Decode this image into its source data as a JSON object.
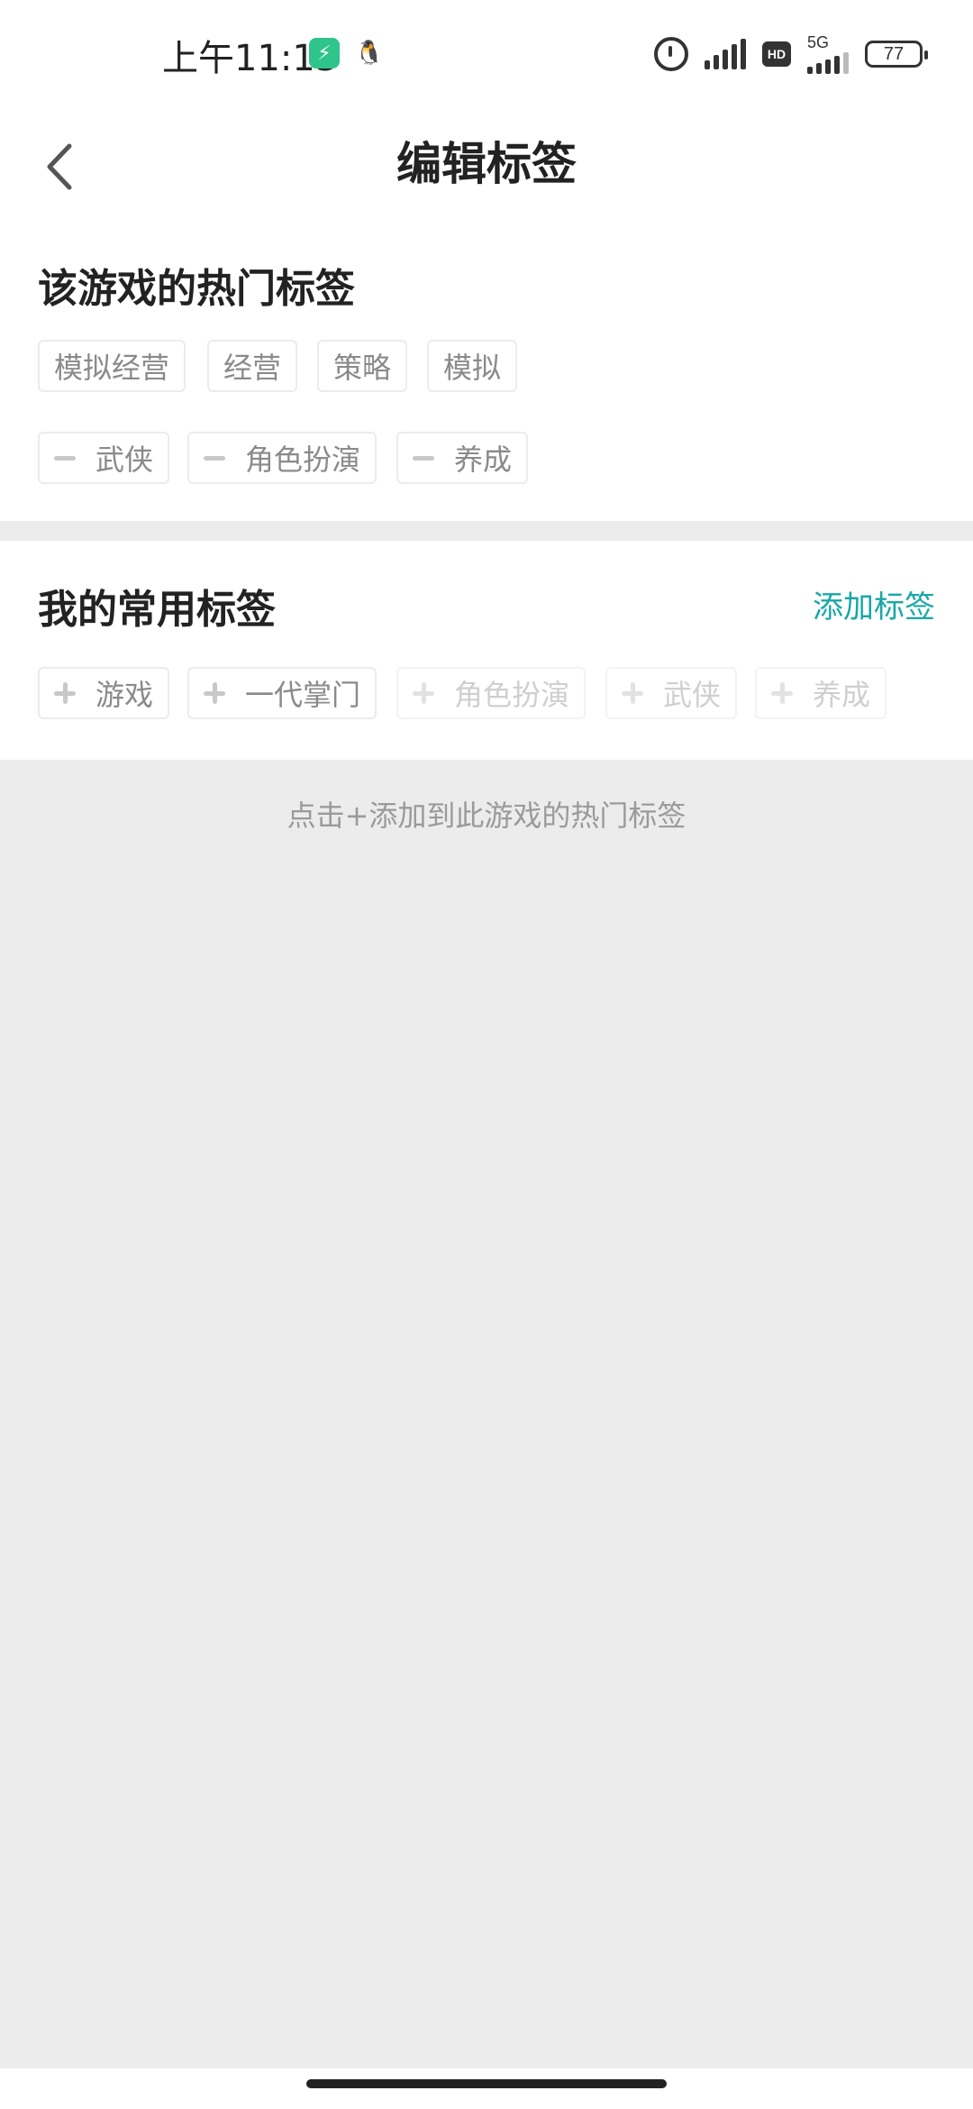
{
  "status_bar": {
    "time": "上午11:13",
    "app_icon": "shield-app-icon",
    "qq_icon": "qq-penguin-icon",
    "network_label": "5G",
    "hd_label": "HD",
    "battery": "77"
  },
  "header": {
    "title": "编辑标签",
    "back_icon": "chevron-left-icon"
  },
  "hot_tags": {
    "title": "该游戏的热门标签",
    "row1": [
      "模拟经营",
      "经营",
      "策略",
      "模拟"
    ],
    "row2": [
      "武侠",
      "角色扮演",
      "养成"
    ]
  },
  "my_tags": {
    "title": "我的常用标签",
    "add_link": "添加标签",
    "items": [
      "游戏",
      "一代掌门",
      "角色扮演",
      "武侠",
      "养成"
    ],
    "faded_flags": [
      false,
      false,
      true,
      true,
      true
    ]
  },
  "hint": "点击+添加到此游戏的热门标签",
  "colors": {
    "accent": "#19a7a7",
    "background": "#ececec",
    "tag_text": "#8a8a8a",
    "tag_faded": "#cfcfcf"
  }
}
